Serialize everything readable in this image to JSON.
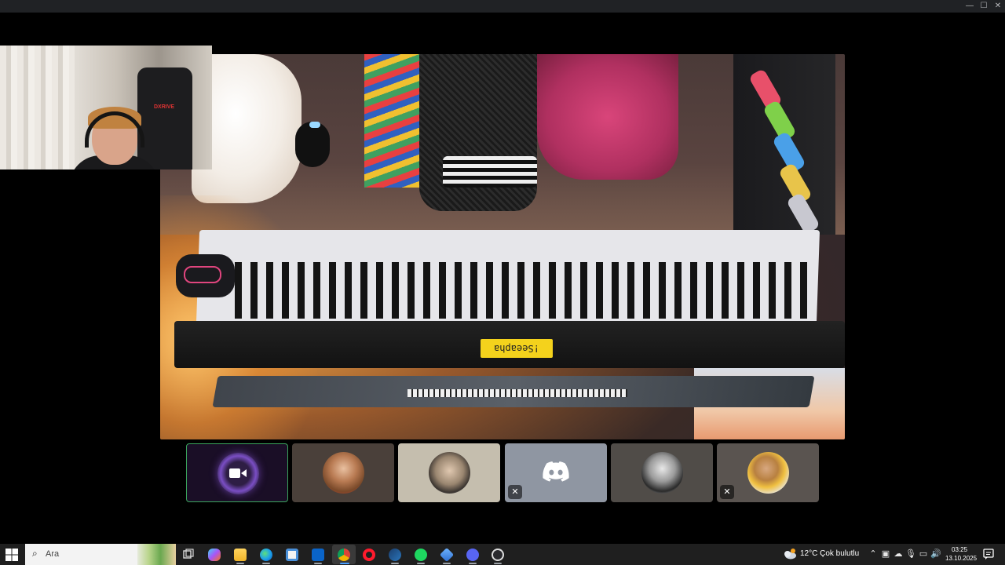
{
  "window": {
    "minimize_glyph": "—",
    "maximize_glyph": "☐",
    "close_glyph": "✕"
  },
  "self_camera": {
    "chair_brand": "DXRIVE"
  },
  "stream": {
    "lcd_text": "!Seeapha"
  },
  "participants": [
    {
      "name": "self-camera-tile",
      "muted": false,
      "active": true
    },
    {
      "name": "participant-2",
      "muted": false
    },
    {
      "name": "participant-3",
      "muted": false
    },
    {
      "name": "participant-4-discord-default",
      "muted": true
    },
    {
      "name": "participant-5",
      "muted": false
    },
    {
      "name": "participant-6",
      "muted": true
    }
  ],
  "taskbar": {
    "search_placeholder": "Ara",
    "apps": [
      "task-view",
      "copilot",
      "file-explorer",
      "edge",
      "microsoft-store",
      "outlook",
      "chrome",
      "opera",
      "steam",
      "spotify",
      "app-blue",
      "discord",
      "obs"
    ],
    "weather": "12°C  Çok bulutlu",
    "time": "03:25",
    "date": "13.10.2025"
  },
  "colors": {
    "speaking_border": "#3ba55d",
    "discord_blurple": "#5865f2",
    "taskbar_bg": "#1f1f1f"
  }
}
